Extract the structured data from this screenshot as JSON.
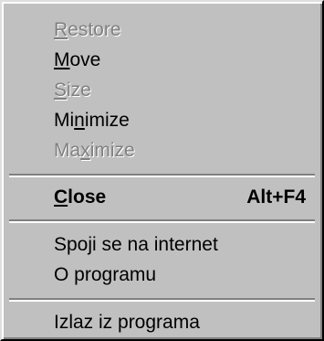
{
  "menu": {
    "items": [
      {
        "pre": "",
        "key": "R",
        "post": "estore",
        "enabled": false
      },
      {
        "pre": "",
        "key": "M",
        "post": "ove",
        "enabled": true
      },
      {
        "pre": "",
        "key": "S",
        "post": "ize",
        "enabled": false
      },
      {
        "pre": "Mi",
        "key": "n",
        "post": "imize",
        "enabled": true
      },
      {
        "pre": "Ma",
        "key": "x",
        "post": "imize",
        "enabled": false
      },
      {
        "pre": "",
        "key": "C",
        "post": "lose",
        "shortcut": "Alt+F4",
        "enabled": true,
        "bold": true
      },
      {
        "text": "Spoji se na internet",
        "enabled": true
      },
      {
        "text": "O programu",
        "enabled": true
      },
      {
        "text": "Izlaz iz programa",
        "enabled": true
      }
    ]
  }
}
